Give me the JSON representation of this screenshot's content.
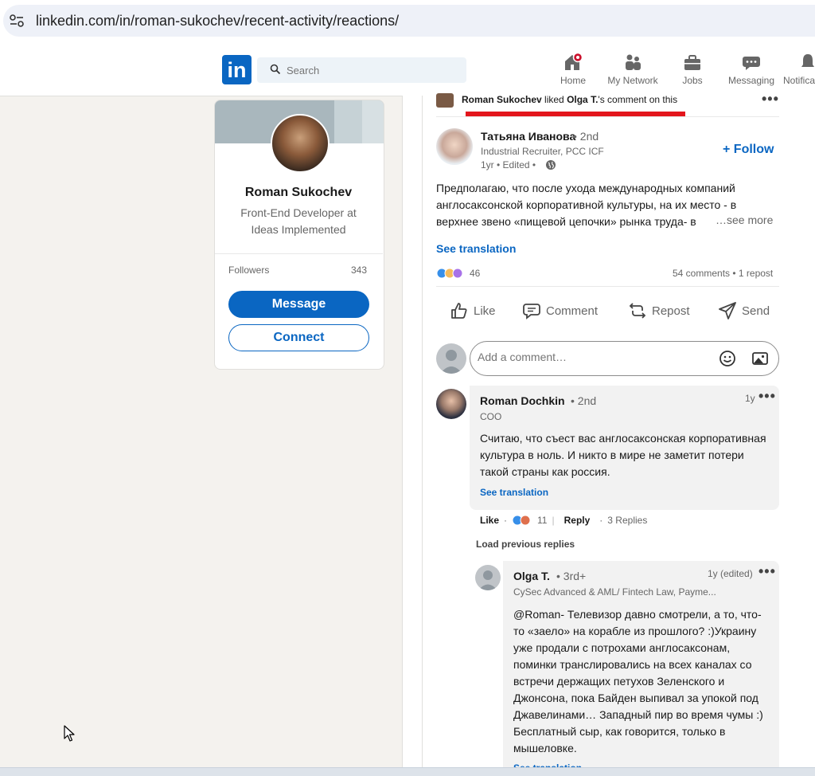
{
  "browser": {
    "url": "linkedin.com/in/roman-sukochev/recent-activity/reactions/"
  },
  "nav": {
    "logo": "in",
    "search_placeholder": "Search",
    "items": [
      {
        "label": "Home",
        "icon": "home-icon",
        "badge_color": "#cb112d"
      },
      {
        "label": "My Network",
        "icon": "people-icon"
      },
      {
        "label": "Jobs",
        "icon": "briefcase-icon"
      },
      {
        "label": "Messaging",
        "icon": "chat-icon"
      },
      {
        "label": "Notifications",
        "icon": "bell-icon"
      }
    ]
  },
  "profile": {
    "name": "Roman Sukochev",
    "headline": "Front-End Developer at Ideas Implemented",
    "followers_label": "Followers",
    "followers_count": "343",
    "message_label": "Message",
    "connect_label": "Connect"
  },
  "activity": {
    "actor": "Roman Sukochev",
    "verb": " liked ",
    "target": "Olga T.",
    "suffix": "'s comment on this"
  },
  "post": {
    "author_name": "Татьяна Иванова",
    "author_degree": "• 2nd",
    "author_title": "Industrial Recruiter, PCC ICF",
    "time": "1yr • Edited •",
    "follow_label": "+ Follow",
    "text": "Предполагаю, что после ухода международных компаний англосаксонской корпоративной культуры, на их место - в верхнее звено «пищевой цепочки» рынка труда- в",
    "see_more": "…see more",
    "see_translation": "See translation",
    "reaction_count": "46",
    "comments_reposts": "54 comments • 1 repost",
    "actions": [
      "Like",
      "Comment",
      "Repost",
      "Send"
    ]
  },
  "comment_box": {
    "placeholder": "Add a comment…"
  },
  "comment1": {
    "name": "Roman Dochkin",
    "degree": "• 2nd",
    "title": "COO",
    "time": "1y",
    "text": "Считаю, что съест вас англосаксонская корпоративная культура в ноль. И никто в мире не заметит потери такой страны как россия.",
    "translation": "See translation",
    "like": "Like",
    "reaction_count": "11",
    "reply": "Reply",
    "replies": "3 Replies",
    "load_previous": "Load previous replies"
  },
  "reply1": {
    "name": "Olga T.",
    "degree": "• 3rd+",
    "title": "CySec Advanced & AML/ Fintech Law, Payme...",
    "time": "1y (edited)",
    "text": "@Roman- Телевизор давно смотрели, а то, что-то «заело» на корабле из прошлого? :)Украину уже продали с потрохами англосаксонам, поминки транслировались на всех каналах со встречи держащих петухов Зеленского и Джонсона, пока Байден выпивал за упокой под Джавелинами… Западный пир во время чумы :) Бесплатный сыр, как говорится, только в мышеловке.",
    "translation": "See translation"
  },
  "colors": {
    "linkedin_blue": "#0a66c2",
    "highlight_red": "#e3151c"
  }
}
